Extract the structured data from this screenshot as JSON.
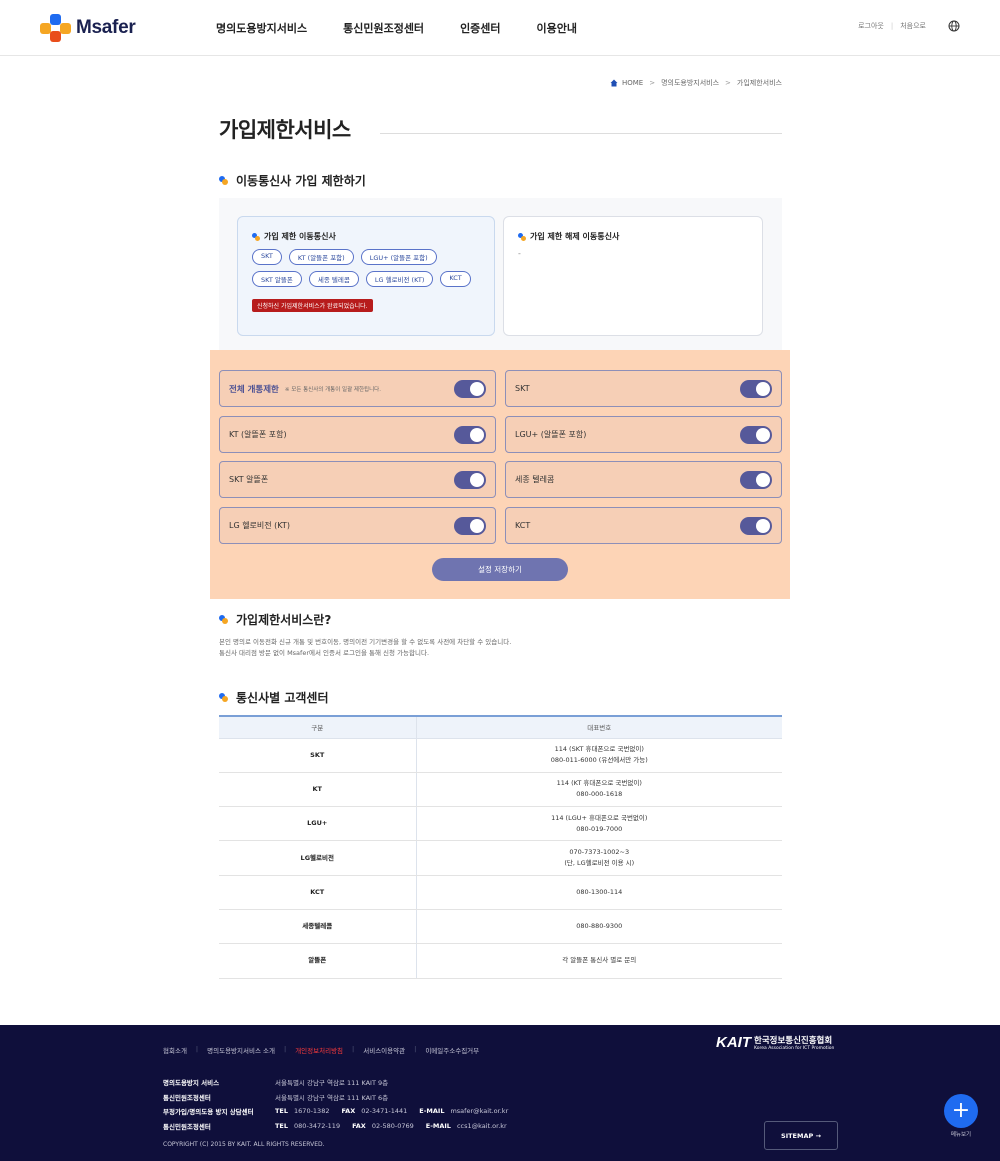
{
  "header": {
    "logo_text": "Msafer",
    "nav": [
      "명의도용방지서비스",
      "통신민원조정센터",
      "인증센터",
      "이용안내"
    ],
    "util": {
      "logout": "로그아웃",
      "home": "처음으로"
    },
    "icons": {
      "globe": "globe-icon"
    }
  },
  "breadcrumb": {
    "home": "HOME",
    "level1": "명의도용방지서비스",
    "level2": "가입제한서비스"
  },
  "page_title": "가입제한서비스",
  "section1": {
    "title": "이동통신사 가입 제한하기",
    "restricted_card": {
      "title": "가입 제한 이동통신사",
      "chips": [
        "SKT",
        "KT (알뜰폰 포함)",
        "LGU+ (알뜰폰 포함)",
        "SKT 알뜰폰",
        "세종 텔레콤",
        "LG 헬로비전 (KT)",
        "KCT"
      ],
      "notice": "신청하신 가입제한서비스가 완료되었습니다."
    },
    "released_card": {
      "title": "가입 제한 해제 이동통신사",
      "value": "-"
    }
  },
  "toggles": {
    "all": {
      "label": "전체 개통제한",
      "desc": "※ 모든 통신사의 개통이 일괄 제한됩니다.",
      "on": true
    },
    "items": [
      {
        "label": "SKT",
        "on": true
      },
      {
        "label": "KT (알뜰폰 포함)",
        "on": true
      },
      {
        "label": "LGU+ (알뜰폰 포함)",
        "on": true
      },
      {
        "label": "SKT 알뜰폰",
        "on": true
      },
      {
        "label": "세종 텔레콤",
        "on": true
      },
      {
        "label": "LG 헬로비전 (KT)",
        "on": true
      },
      {
        "label": "KCT",
        "on": true
      }
    ],
    "save_label": "설정 저장하기"
  },
  "section2": {
    "title": "가입제한서비스란?",
    "line1": "본인 명의로 이동전화 신규 개통 및 번호이동, 명의이전 기기변경을 할 수 없도록 사전에 차단할 수 있습니다.",
    "line2": "통신사 대리점 방문 없이 Msafer에서 인증서 로그인을 통해 신청 가능합니다."
  },
  "section3": {
    "title": "통신사별 고객센터",
    "headers": [
      "구분",
      "대표번호"
    ],
    "rows": [
      {
        "name": "SKT",
        "line1": "114 (SKT 휴대폰으로 국번없이)",
        "line2": "080-011-6000 (유선에서만 가능)"
      },
      {
        "name": "KT",
        "line1": "114 (KT 휴대폰으로 국번없이)",
        "line2": "080-000-1618"
      },
      {
        "name": "LGU+",
        "line1": "114 (LGU+ 휴대폰으로 국번없이)",
        "line2": "080-019-7000"
      },
      {
        "name": "LG헬로비전",
        "line1": "070-7373-1002~3",
        "line2": "(단, LG헬로비전 이용 시)"
      },
      {
        "name": "KCT",
        "line1": "080-1300-114",
        "line2": ""
      },
      {
        "name": "세종텔레콤",
        "line1": "080-880-9300",
        "line2": ""
      },
      {
        "name": "알뜰폰",
        "line1": "각 알뜰폰 통신사 별로 문의",
        "line2": ""
      }
    ]
  },
  "footer": {
    "links": [
      "협회소개",
      "명의도용방지서비스 소개",
      "개인정보처리방침",
      "서비스이용약관",
      "이메일주소수집거부"
    ],
    "rows": [
      {
        "k": "명의도용방지 서비스",
        "v": "서울특별시 강남구 역삼로 111 KAIT 9층"
      },
      {
        "k": "통신민원조정센터",
        "v": "서울특별시 강남구 역삼로 111 KAIT 6층"
      }
    ],
    "contact1": {
      "k": "부정가입/명의도용 방지 상담센터",
      "tel": "1670-1382",
      "fax": "02-3471-1441",
      "email": "msafer@kait.or.kr"
    },
    "contact2": {
      "k": "통신민원조정센터",
      "tel": "080-3472-119",
      "fax": "02-580-0769",
      "email": "ccs1@kait.or.kr"
    },
    "labels": {
      "tel": "TEL",
      "fax": "FAX",
      "email": "E-MAIL"
    },
    "copyright": "COPYRIGHT (C) 2015 BY KAIT. ALL RIGHTS RESERVED.",
    "kait": {
      "mark": "KAIT",
      "name": "한국정보통신진흥협회",
      "eng": "Korea Association for ICT Promotion"
    },
    "sitemap": "SITEMAP →",
    "fab_label": "메뉴보기"
  },
  "colors": {
    "brand_navy": "#1a2150",
    "toggle_on": "#56599a",
    "highlight_panel": "#fdd4b6",
    "notice_red": "#b71c1c",
    "footer_bg": "#0f0f3b",
    "fab_blue": "#1f6bf0"
  }
}
